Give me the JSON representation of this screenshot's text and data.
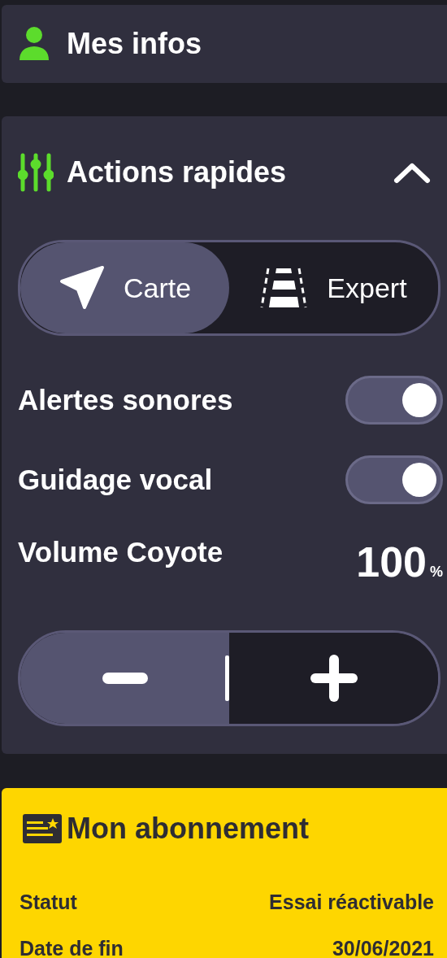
{
  "my_info": {
    "title": "Mes infos"
  },
  "quick_actions": {
    "title": "Actions rapides",
    "expanded": true,
    "mode_switch": [
      {
        "label": "Carte",
        "selected": true
      },
      {
        "label": "Expert",
        "selected": false
      }
    ],
    "toggles": [
      {
        "label": "Alertes sonores",
        "on": true
      },
      {
        "label": "Guidage vocal",
        "on": true
      }
    ],
    "volume": {
      "label": "Volume Coyote",
      "value": "100",
      "unit": "%"
    }
  },
  "subscription": {
    "title": "Mon abonnement",
    "rows": [
      {
        "label": "Statut",
        "value": "Essai réactivable"
      },
      {
        "label": "Date de fin",
        "value": "30/06/2021"
      }
    ]
  }
}
